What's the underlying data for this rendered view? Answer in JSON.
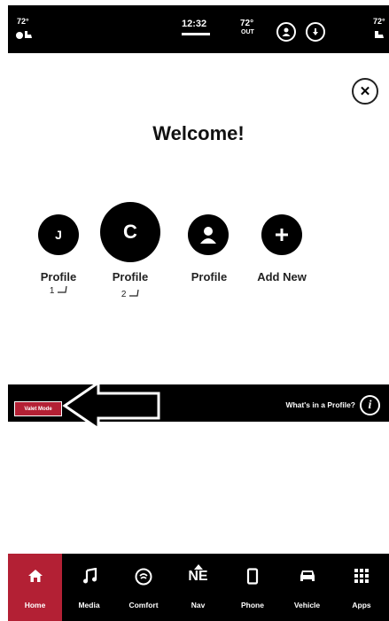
{
  "status_bar": {
    "left_temp": "72°",
    "time": "12:32",
    "outside_temp": "72°",
    "outside_label": "OUT",
    "right_temp": "72°"
  },
  "dialog": {
    "title": "Welcome!",
    "close_icon": "close-icon"
  },
  "profiles": [
    {
      "initial": "J",
      "label": "Profile",
      "sub": "1"
    },
    {
      "initial": "C",
      "label": "Profile",
      "sub": "2"
    },
    {
      "icon": "person-icon",
      "label": "Profile"
    },
    {
      "icon": "plus-icon",
      "label": "Add New"
    }
  ],
  "banner": {
    "valet_label": "Valet Mode",
    "whats_label": "What's in a Profile?",
    "info_icon": "i"
  },
  "nav": {
    "items": [
      {
        "label": "Home",
        "icon": "home-icon",
        "active": true
      },
      {
        "label": "Media",
        "icon": "music-icon"
      },
      {
        "label": "Comfort",
        "icon": "comfort-icon"
      },
      {
        "label": "Nav",
        "icon": "compass-icon",
        "glyph": "NE"
      },
      {
        "label": "Phone",
        "icon": "phone-icon"
      },
      {
        "label": "Vehicle",
        "icon": "car-icon"
      },
      {
        "label": "Apps",
        "icon": "apps-grid-icon"
      }
    ]
  },
  "colors": {
    "accent": "#b32034",
    "bar": "#000000"
  }
}
